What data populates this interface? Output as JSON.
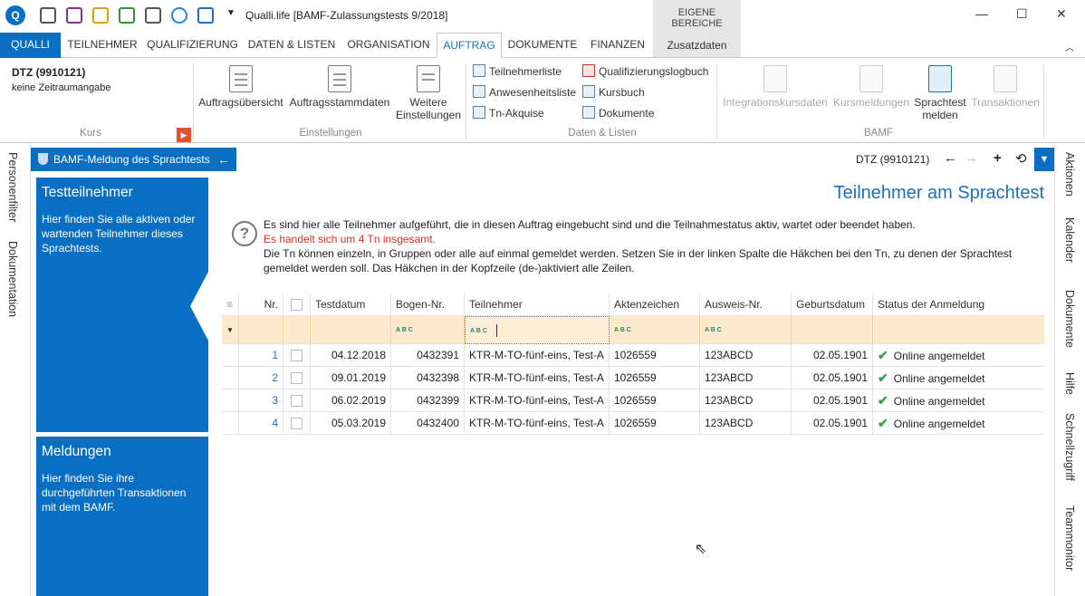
{
  "window": {
    "title": "Qualli.life [BAMF-Zulassungstests 9/2018]",
    "eigene_label": "EIGENE BEREICHE",
    "zusatz_tab": "Zusatzdaten",
    "minimize": "—",
    "maximize": "☐",
    "close": "✕"
  },
  "tabs": [
    "QUALLI",
    "TEILNEHMER",
    "QUALIFIZIERUNG",
    "DATEN & LISTEN",
    "ORGANISATION",
    "AUFTRAG",
    "DOKUMENTE",
    "FINANZEN"
  ],
  "ribbon": {
    "kurs": {
      "title": "DTZ (9910121)",
      "sub": "keine Zeitraumangabe",
      "group": "Kurs"
    },
    "einstellungen": {
      "btn1": "Auftragsübersicht",
      "btn2": "Auftragsstammdaten",
      "btn3a": "Weitere",
      "btn3b": "Einstellungen",
      "group": "Einstellungen"
    },
    "daten": {
      "items": [
        "Teilnehmerliste",
        "Anwesenheitsliste",
        "Tn-Akquise",
        "Qualifizierungslogbuch",
        "Kursbuch",
        "Dokumente"
      ],
      "group": "Daten & Listen"
    },
    "bamf": {
      "btn1": "Integrationskursdaten",
      "btn2": "Kursmeldungen",
      "btn3a": "Sprachtest",
      "btn3b": "melden",
      "btn4": "Transaktionen",
      "group": "BAMF"
    }
  },
  "left_side": [
    "Personenfilter",
    "Dokumentation"
  ],
  "right_side": [
    "Aktionen",
    "Kalender",
    "Dokumente",
    "Hilfe",
    "Schnellzugriff",
    "Teammonitor"
  ],
  "panel": {
    "title": "BAMF-Meldung des Sprachtests",
    "context": "DTZ (9910121)"
  },
  "cards": [
    {
      "title": "Testteilnehmer",
      "desc": "Hier finden Sie alle aktiven oder wartenden Teilnehmer dieses Sprachtests."
    },
    {
      "title": "Meldungen",
      "desc": "Hier finden Sie ihre durchgeführten Transaktionen mit dem BAMF."
    }
  ],
  "main": {
    "heading": "Teilnehmer am Sprachtest",
    "info1": "Es sind hier alle Teilnehmer aufgeführt, die in diesen Auftrag eingebucht sind und die Teilnahmestatus aktiv, wartet oder beendet haben.",
    "info2": "Es handelt sich um 4 Tn insgesamt.",
    "info3": "Die Tn können einzeln, in Gruppen oder alle auf einmal gemeldet werden. Setzen Sie in der linken Spalte die Häkchen bei den Tn, zu denen der Sprachtest gemeldet werden soll. Das Häkchen in der Kopfzeile (de-)aktiviert alle Zeilen."
  },
  "grid": {
    "headers": [
      "Nr.",
      "Testdatum",
      "Bogen-Nr.",
      "Teilnehmer",
      "Aktenzeichen",
      "Ausweis-Nr.",
      "Geburtsdatum",
      "Status der Anmeldung"
    ],
    "rows": [
      {
        "nr": "1",
        "testdatum": "04.12.2018",
        "bogen": "0432391",
        "teilnehmer": "KTR-M-TO-fünf-eins, Test-A",
        "akten": "1026559",
        "ausweis": "123ABCD",
        "geburt": "02.05.1901",
        "status": "Online angemeldet"
      },
      {
        "nr": "2",
        "testdatum": "09.01.2019",
        "bogen": "0432398",
        "teilnehmer": "KTR-M-TO-fünf-eins, Test-A",
        "akten": "1026559",
        "ausweis": "123ABCD",
        "geburt": "02.05.1901",
        "status": "Online angemeldet"
      },
      {
        "nr": "3",
        "testdatum": "06.02.2019",
        "bogen": "0432399",
        "teilnehmer": "KTR-M-TO-fünf-eins, Test-A",
        "akten": "1026559",
        "ausweis": "123ABCD",
        "geburt": "02.05.1901",
        "status": "Online angemeldet"
      },
      {
        "nr": "4",
        "testdatum": "05.03.2019",
        "bogen": "0432400",
        "teilnehmer": "KTR-M-TO-fünf-eins, Test-A",
        "akten": "1026559",
        "ausweis": "123ABCD",
        "geburt": "02.05.1901",
        "status": "Online angemeldet"
      }
    ]
  }
}
